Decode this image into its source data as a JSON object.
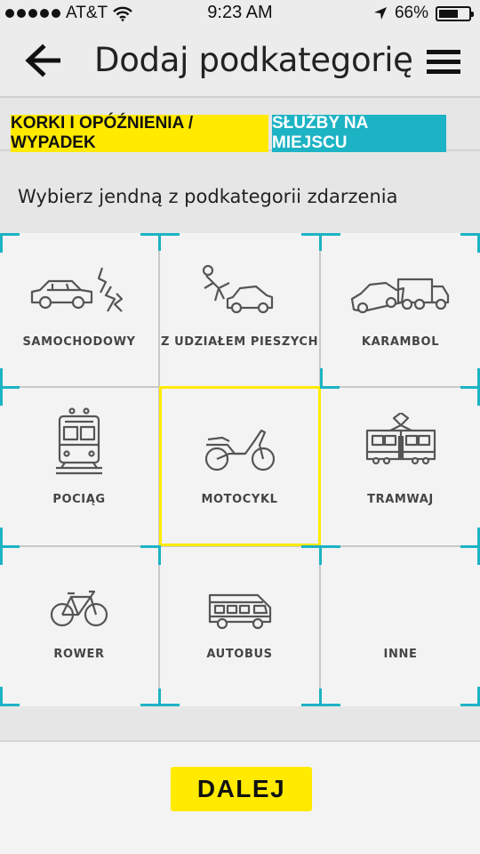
{
  "status_bar": {
    "carrier": "AT&T",
    "time": "9:23 AM",
    "battery": "66%",
    "battery_level": 0.66,
    "icons": [
      "signal-dots-icon",
      "wifi-icon",
      "location-arrow-icon",
      "battery-icon"
    ]
  },
  "header": {
    "title": "Dodaj podkategorię",
    "back_icon": "arrow-left-icon",
    "menu_icon": "hamburger-menu-icon"
  },
  "tabs": [
    {
      "label": "KORKI I OPÓŹNIENIA / WYPADEK",
      "active": true,
      "color": "#ffea00"
    },
    {
      "label": "SŁUŻBY NA MIEJSCU",
      "active": false,
      "color": "#1cb3c4"
    }
  ],
  "instruction": "Wybierz jendną z podkategorii zdarzenia",
  "subcategories": [
    {
      "label": "SAMOCHODOWY",
      "icon": "car-crash-icon"
    },
    {
      "label": "Z UDZIAŁEM PIESZYCH",
      "icon": "pedestrian-car-icon"
    },
    {
      "label": "KARAMBOL",
      "icon": "pileup-icon"
    },
    {
      "label": "POCIĄG",
      "icon": "train-icon"
    },
    {
      "label": "MOTOCYKL",
      "icon": "motorcycle-icon",
      "selected": true
    },
    {
      "label": "TRAMWAJ",
      "icon": "tram-icon"
    },
    {
      "label": "ROWER",
      "icon": "bicycle-icon"
    },
    {
      "label": "AUTOBUS",
      "icon": "bus-icon"
    },
    {
      "label": "INNE",
      "icon": ""
    }
  ],
  "next_button": "DALEJ",
  "colors": {
    "accent_yellow": "#ffea00",
    "accent_teal": "#1cb3c4"
  }
}
